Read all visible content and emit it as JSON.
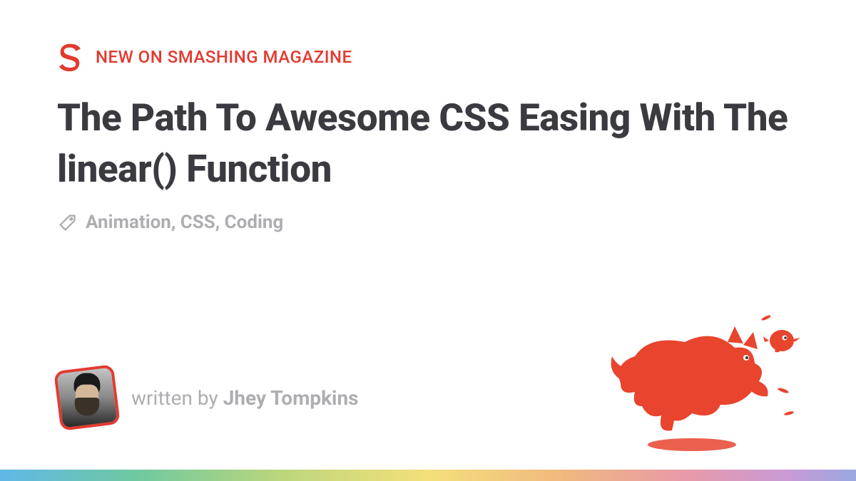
{
  "header": {
    "kicker": "NEW ON SMASHING MAGAZINE"
  },
  "article": {
    "title": "The Path To Awesome CSS Easing With The linear() Function",
    "tags": "Animation, CSS, Coding"
  },
  "byline": {
    "prefix": "written by ",
    "author": "Jhey Tompkins"
  },
  "colors": {
    "brand": "#e33a2f",
    "headline": "#3a3a40",
    "muted": "#aeaeb2"
  }
}
